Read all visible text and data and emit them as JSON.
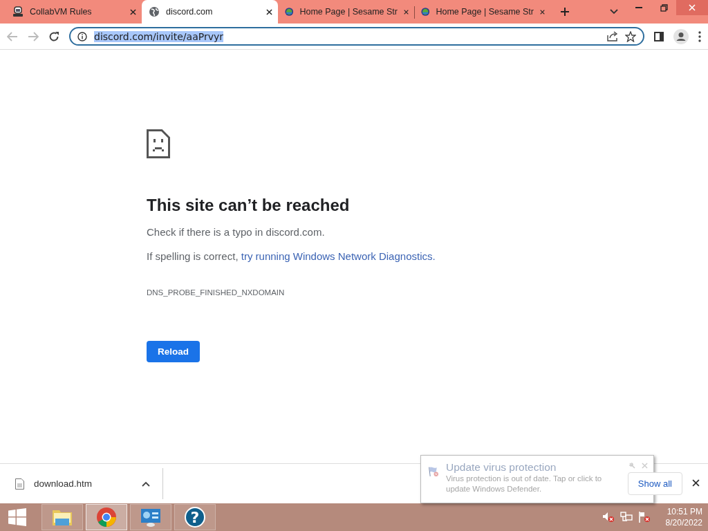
{
  "tabs": [
    {
      "kind": "vm",
      "title": "CollabVM Rules",
      "selected": false
    },
    {
      "kind": "globe",
      "title": "discord.com",
      "selected": true
    },
    {
      "kind": "badge",
      "title": "Home Page | Sesame Str",
      "selected": false
    },
    {
      "kind": "badge",
      "title": "Home Page | Sesame Str",
      "selected": false
    }
  ],
  "address_bar": {
    "url": "discord.com/invite/aaPrvyr",
    "selected": true
  },
  "error_page": {
    "heading": "This site can’t be reached",
    "check": "Check if there is a typo in discord.com.",
    "spelling": "If spelling is correct,",
    "link": "try running Windows Network Diagnostics.",
    "code": "DNS_PROBE_FINISHED_NXDOMAIN",
    "button": "Reload"
  },
  "download_bar": {
    "items": [
      {
        "name": "download.htm"
      }
    ],
    "show_all": "Show all"
  },
  "taskbar": {
    "apps": [
      {
        "kind": "explorer",
        "selected": false
      },
      {
        "kind": "chrome",
        "selected": true
      },
      {
        "kind": "control",
        "selected": false
      },
      {
        "kind": "help",
        "glyph": "?",
        "selected": false
      }
    ],
    "time": "10:51 PM",
    "date": "8/20/2022"
  },
  "notification": {
    "title": "Update virus protection",
    "body": "Virus protection is out of date. Tap or click to update Windows Defender."
  }
}
